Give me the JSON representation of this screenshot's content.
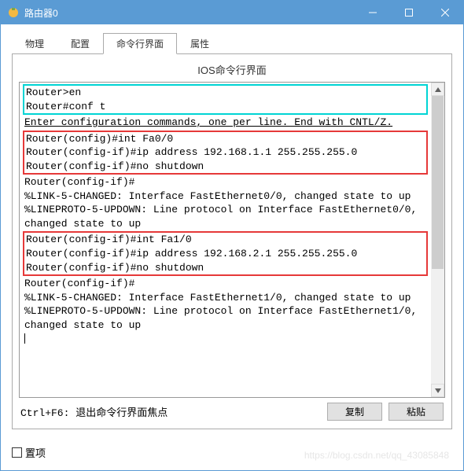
{
  "window": {
    "title": "路由器0"
  },
  "tabs": {
    "items": [
      {
        "label": "物理",
        "active": false
      },
      {
        "label": "配置",
        "active": false
      },
      {
        "label": "命令行界面",
        "active": true
      },
      {
        "label": "属性",
        "active": false
      }
    ]
  },
  "panel": {
    "title": "IOS命令行界面"
  },
  "cli": {
    "block_cyan": [
      "Router>en",
      "Router#conf t"
    ],
    "line_enter": "Enter configuration commands, one per line.  End with CNTL/Z.",
    "block_red1": [
      "Router(config)#int Fa0/0",
      "Router(config-if)#ip address 192.168.1.1 255.255.255.0",
      "Router(config-if)#no shutdown"
    ],
    "block_mid": [
      "",
      "Router(config-if)#",
      "%LINK-5-CHANGED: Interface FastEthernet0/0, changed state to up",
      "",
      "%LINEPROTO-5-UPDOWN: Line protocol on Interface FastEthernet0/0, changed state to up",
      ""
    ],
    "block_red2": [
      "Router(config-if)#int Fa1/0",
      "Router(config-if)#ip address 192.168.2.1 255.255.255.0",
      "Router(config-if)#no shutdown"
    ],
    "block_tail": [
      "",
      "Router(config-if)#",
      "%LINK-5-CHANGED: Interface FastEthernet1/0, changed state to up",
      "",
      "%LINEPROTO-5-UPDOWN: Line protocol on Interface FastEthernet1/0, changed state to up"
    ]
  },
  "help": {
    "text": "Ctrl+F6: 退出命令行界面焦点",
    "copy": "复制",
    "paste": "粘贴"
  },
  "footer": {
    "checkbox_label": "置项"
  },
  "watermark": "https://blog.csdn.net/qq_43085848"
}
